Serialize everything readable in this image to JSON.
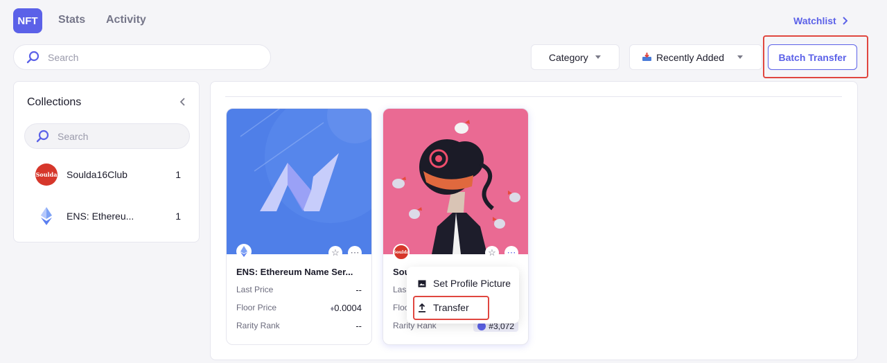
{
  "top_tabs": [
    {
      "label": "NFT"
    },
    {
      "label": "Stats"
    },
    {
      "label": "Activity"
    }
  ],
  "watchlist_label": "Watchlist",
  "search": {
    "placeholder": "Search"
  },
  "filters": {
    "category_label": "Category",
    "sort_label": "Recently Added",
    "batch_transfer_label": "Batch Transfer"
  },
  "sidebar": {
    "title": "Collections",
    "search_placeholder": "Search",
    "items": [
      {
        "logo_text": "Soulda",
        "label": "Soulda16Club",
        "count": "1"
      },
      {
        "label": "ENS: Ethereu...",
        "count": "1"
      }
    ]
  },
  "cards": [
    {
      "title": "ENS: Ethereum Name Ser...",
      "rows": [
        {
          "label": "Last Price",
          "value": "--"
        },
        {
          "label": "Floor Price",
          "value": "0.0004"
        },
        {
          "label": "Rarity Rank",
          "value": "--"
        }
      ]
    },
    {
      "title": "Sou",
      "badge_text": "Soulda",
      "rows": [
        {
          "label": "Las"
        },
        {
          "label": "Floo"
        },
        {
          "label": "Rarity Rank",
          "value": "#3,072"
        }
      ]
    }
  ],
  "context_menu": {
    "items": [
      {
        "label": "Set Profile Picture"
      },
      {
        "label": "Transfer"
      }
    ]
  },
  "colors": {
    "accent": "#5b61e8",
    "highlight": "#e0463f",
    "ens_bg": "#4f7fe8",
    "soulda_bg": "#ea6a93"
  }
}
